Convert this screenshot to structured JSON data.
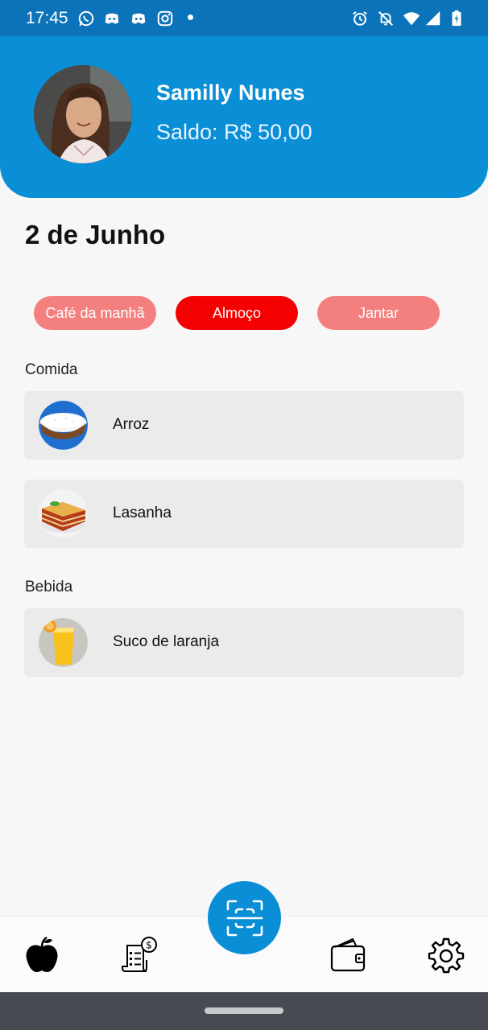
{
  "status_bar": {
    "time": "17:45",
    "left_icons": [
      "whatsapp-icon",
      "discord-icon",
      "discord-icon",
      "instagram-icon",
      "notification-dot"
    ],
    "right_icons": [
      "alarm-icon",
      "bell-off-icon",
      "wifi-icon",
      "signal-icon",
      "battery-charging-icon"
    ]
  },
  "profile": {
    "name": "Samilly Nunes",
    "balance": "Saldo: R$ 50,00"
  },
  "date_title": "2 de Junho",
  "meal_tabs": [
    {
      "label": "Café da manhã",
      "active": false
    },
    {
      "label": "Almoço",
      "active": true
    },
    {
      "label": "Jantar",
      "active": false
    }
  ],
  "sections": [
    {
      "title": "Comida",
      "items": [
        {
          "name": "Arroz",
          "icon": "rice-bowl-image"
        },
        {
          "name": "Lasanha",
          "icon": "lasagna-image"
        }
      ]
    },
    {
      "title": "Bebida",
      "items": [
        {
          "name": "Suco de laranja",
          "icon": "orange-juice-image"
        }
      ]
    }
  ],
  "bottom_nav": {
    "items": [
      "apple-icon",
      "receipt-dollar-icon",
      "qr-scan-icon",
      "wallet-icon",
      "gear-icon"
    ]
  },
  "colors": {
    "primary": "#0a8ed6",
    "status_bar": "#0b73b9",
    "tab_active": "#f40000",
    "tab_inactive": "#f47f7f",
    "card_bg": "#ebebeb",
    "background": "#f7f7f7"
  }
}
